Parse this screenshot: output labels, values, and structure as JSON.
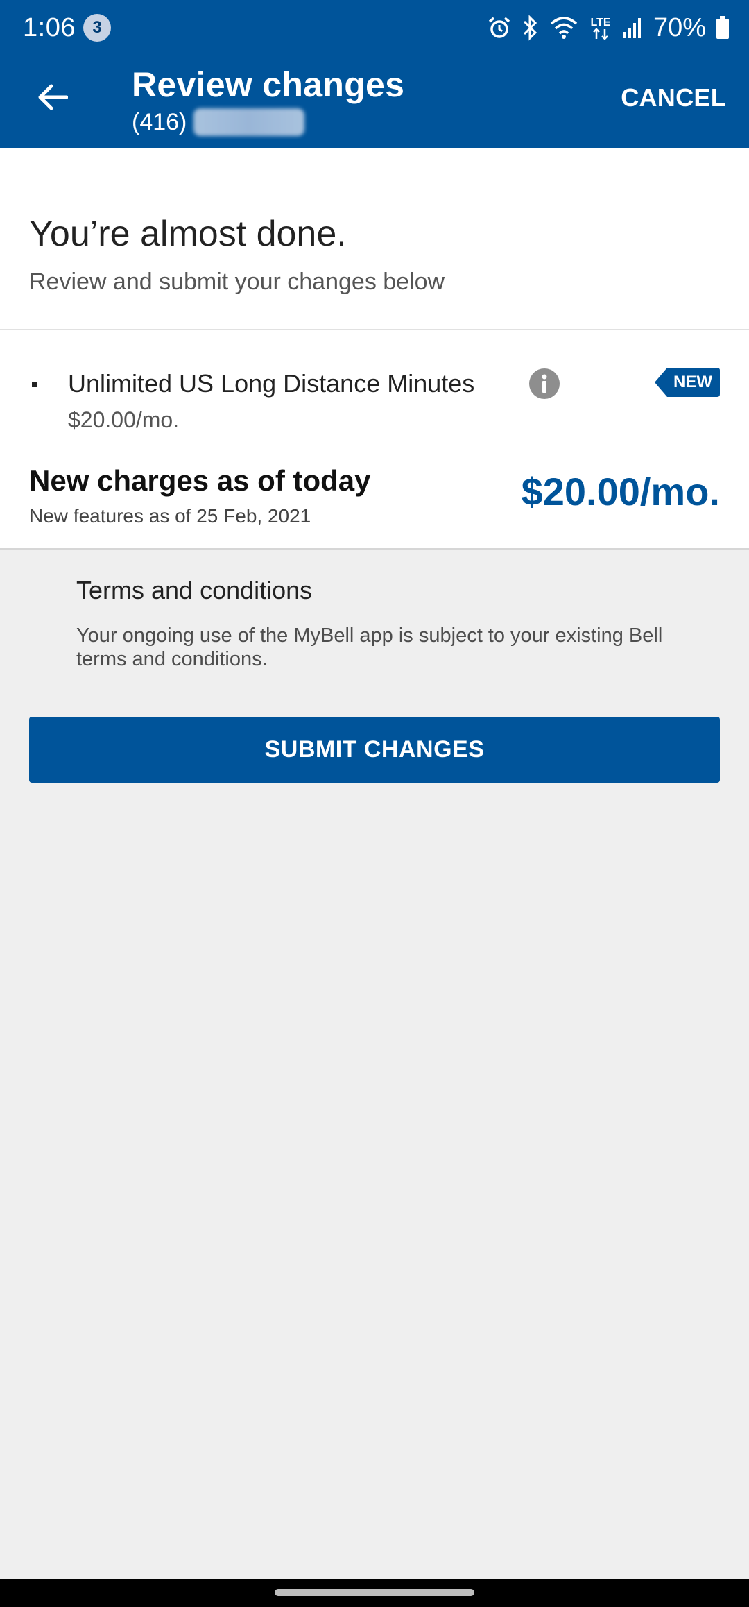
{
  "status_bar": {
    "time": "1:06",
    "notification_count": "3",
    "network": "LTE",
    "battery": "70%"
  },
  "header": {
    "title": "Review changes",
    "phone_prefix": "(416)",
    "cancel_label": "CANCEL"
  },
  "intro": {
    "headline": "You’re almost done.",
    "subtext": "Review and submit your changes below"
  },
  "feature": {
    "name": "Unlimited US Long Distance Minutes",
    "price": "$20.00/mo.",
    "badge": "NEW"
  },
  "charges": {
    "title": "New charges as of today",
    "subtitle": "New features as of 25 Feb, 2021",
    "amount": "$20.00/mo."
  },
  "terms": {
    "title": "Terms and conditions",
    "body": "Your ongoing use of the MyBell app is subject to your existing Bell terms and conditions."
  },
  "actions": {
    "submit_label": "SUBMIT CHANGES"
  },
  "colors": {
    "brand_blue": "#00549a",
    "background": "#efefef"
  }
}
